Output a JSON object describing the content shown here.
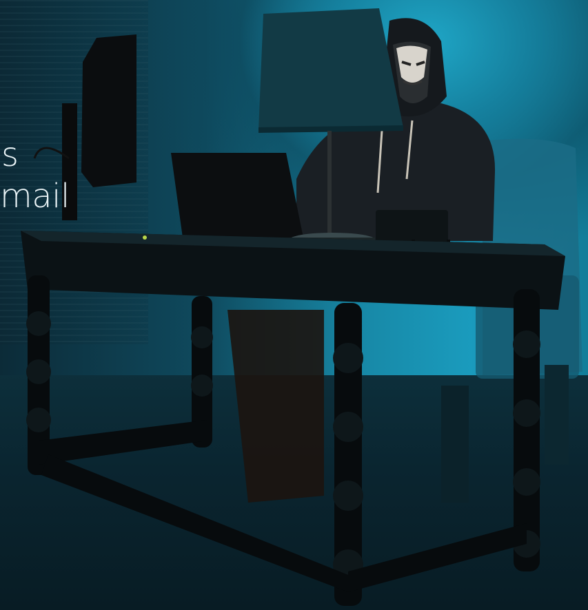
{
  "caption": {
    "line1": "s",
    "line2": "mail"
  }
}
